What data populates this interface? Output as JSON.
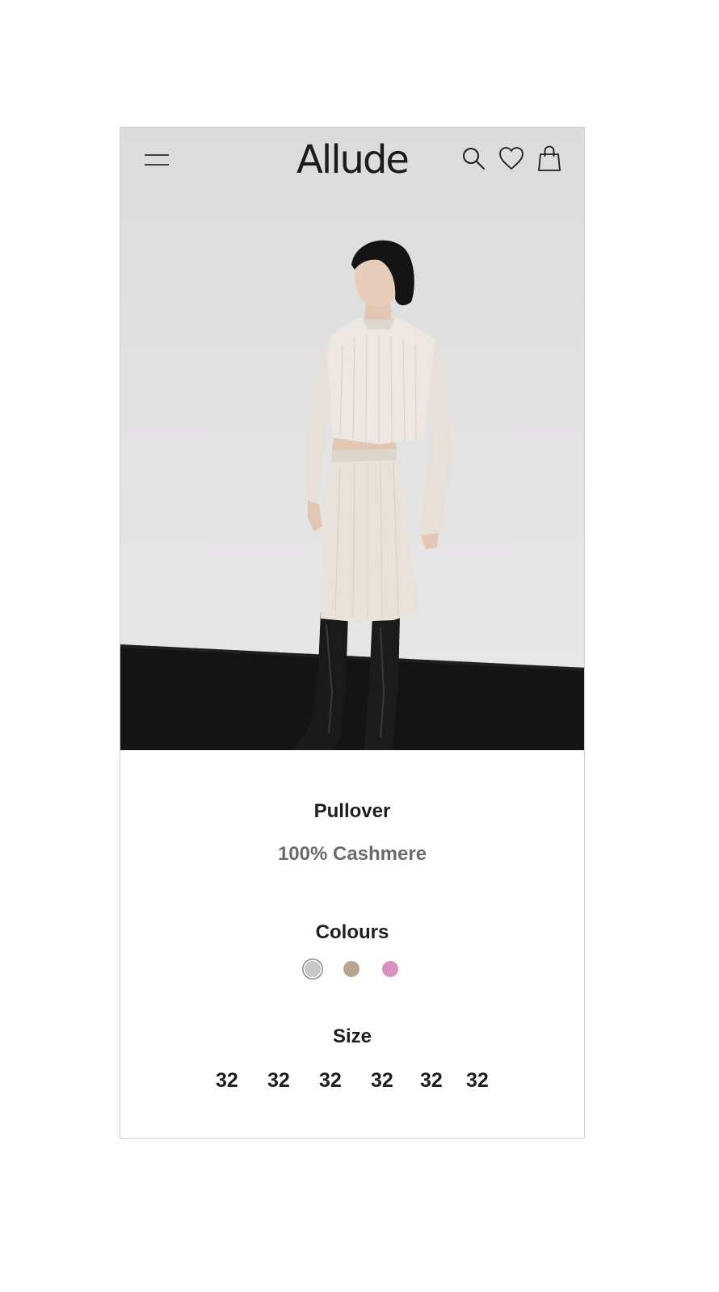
{
  "header": {
    "logo": "Allude",
    "icons": [
      "menu-icon",
      "search-icon",
      "heart-icon",
      "shopping-bag-icon"
    ]
  },
  "product": {
    "name": "Pullover",
    "material": "100% Cashmere"
  },
  "colours": {
    "title": "Colours",
    "options": [
      {
        "color": "#c8c8c8",
        "selected": true
      },
      {
        "color": "#b9a58f",
        "selected": false
      },
      {
        "color": "#d98fc0",
        "selected": false
      }
    ]
  },
  "size": {
    "title": "Size",
    "options": [
      "32",
      "32",
      "32",
      "32",
      "32",
      "32"
    ]
  },
  "colors": {
    "text": "#1e1e1e",
    "muted": "#6b6b6b",
    "backdrop": "#e3e2e3",
    "floor": "#141414"
  }
}
